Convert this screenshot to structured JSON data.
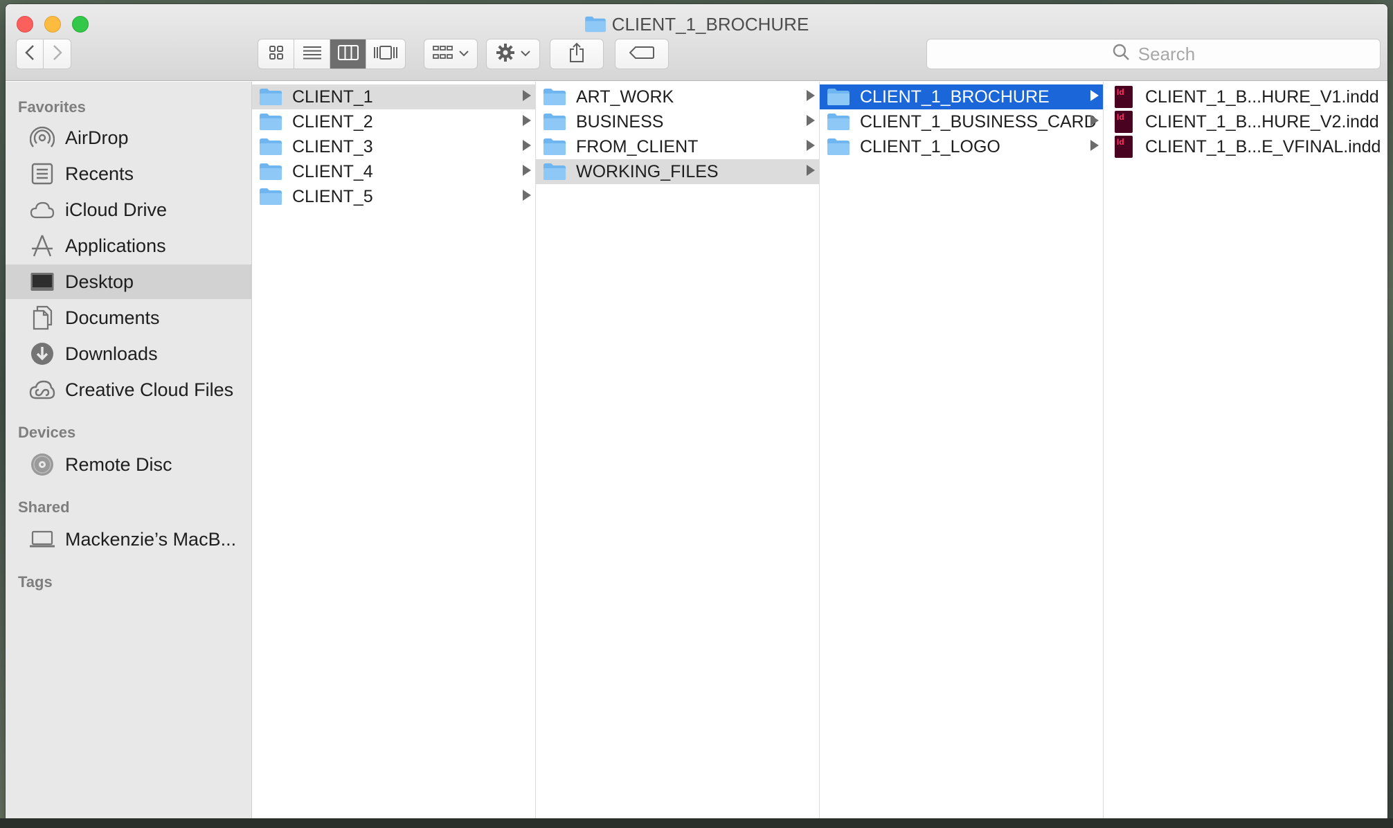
{
  "window": {
    "title": "CLIENT_1_BROCHURE"
  },
  "toolbar": {
    "back_icon": "chevron-left-icon",
    "forward_icon": "chevron-right-icon",
    "view_modes": [
      "icon-view-icon",
      "list-view-icon",
      "column-view-icon",
      "coverflow-view-icon"
    ],
    "active_view": "column-view-icon",
    "group_icon": "group-by-icon",
    "action_icon": "gear-icon",
    "share_icon": "share-icon",
    "tag_icon": "tag-icon",
    "search_placeholder": "Search"
  },
  "sidebar": {
    "favorites_label": "Favorites",
    "favorites": [
      {
        "label": "AirDrop",
        "icon": "airdrop-icon"
      },
      {
        "label": "Recents",
        "icon": "recents-icon"
      },
      {
        "label": "iCloud Drive",
        "icon": "cloud-icon"
      },
      {
        "label": "Applications",
        "icon": "applications-icon"
      },
      {
        "label": "Desktop",
        "icon": "desktop-icon"
      },
      {
        "label": "Documents",
        "icon": "documents-icon"
      },
      {
        "label": "Downloads",
        "icon": "downloads-icon"
      },
      {
        "label": "Creative Cloud Files",
        "icon": "creative-cloud-icon"
      }
    ],
    "selected_favorite": "Desktop",
    "devices_label": "Devices",
    "devices": [
      {
        "label": "Remote Disc",
        "icon": "disc-icon"
      }
    ],
    "shared_label": "Shared",
    "shared": [
      {
        "label": "Mackenzie’s MacB...",
        "icon": "laptop-icon"
      }
    ],
    "tags_label": "Tags"
  },
  "columns": [
    {
      "items": [
        "CLIENT_1",
        "CLIENT_2",
        "CLIENT_3",
        "CLIENT_4",
        "CLIENT_5"
      ],
      "path_selected": "CLIENT_1"
    },
    {
      "items": [
        "ART_WORK",
        "BUSINESS",
        "FROM_CLIENT",
        "WORKING_FILES"
      ],
      "path_selected": "WORKING_FILES"
    },
    {
      "items": [
        "CLIENT_1_BROCHURE",
        "CLIENT_1_BUSINESS_CARD",
        "CLIENT_1_LOGO"
      ],
      "selected": "CLIENT_1_BROCHURE"
    },
    {
      "items": [
        "CLIENT_1_B...HURE_V1.indd",
        "CLIENT_1_B...HURE_V2.indd",
        "CLIENT_1_B...E_VFINAL.indd"
      ],
      "file_icon": "indesign-file-icon"
    }
  ],
  "colors": {
    "selection": "#1b66d8",
    "folder": "#6fb5f0",
    "close": "#fc605c",
    "minimize": "#fdbc40",
    "zoom": "#34c84a"
  }
}
